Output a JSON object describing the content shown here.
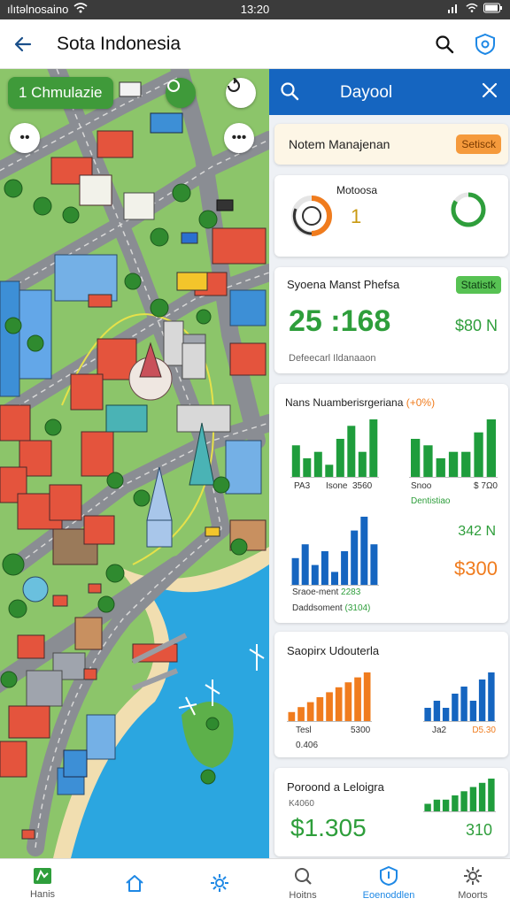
{
  "status_bar": {
    "carrier": "ılıtəlnosaino",
    "time": "13:20"
  },
  "header": {
    "title": "Sota Indonesia"
  },
  "map": {
    "chip_label": "1 Chmulazie",
    "dots_label": "••",
    "more_label": "•••"
  },
  "panel": {
    "title": "Dayool",
    "card1": {
      "label": "Notem Manajenan",
      "badge": "Setisck"
    },
    "card2": {
      "label": "Motoosa",
      "value": "1"
    },
    "card3": {
      "title": "Syoena Manst Phefsa",
      "badge": "Statistk",
      "big_value": "25 :168",
      "side_value": "$80 N",
      "footer": "Defeecarl Ildanaaon"
    },
    "card4": {
      "title": "Nans Nuamberisrgeriana",
      "title_accent": "(+0%)",
      "chart_a_labels": [
        "PA3",
        "Isone",
        "3560"
      ],
      "chart_b_labels": [
        "Snoo",
        "$ 7Ω0"
      ],
      "chart_b_caption": "Dentistiao",
      "value_a": "342 N",
      "chart_c_label": "Sraoe-ment",
      "chart_c_value": "2283",
      "chart_c_caption": "Daddsoment",
      "chart_c_caption_accent": "(3104)",
      "value_b": "$300"
    },
    "card5": {
      "title": "Saopirx Udouterla",
      "labels_left": [
        "Tesl",
        "5300"
      ],
      "sub_left": "0.406",
      "labels_right": [
        "Ja2",
        "D5.30"
      ]
    },
    "card6": {
      "title": "Poroond a Leloigra",
      "sub": "K4060",
      "big_value": "$1.305",
      "side_value": "310"
    }
  },
  "bottom_nav": {
    "items": [
      {
        "label": "Hanis"
      },
      {
        "label": "Hoitns"
      },
      {
        "label": "Eoenoddlen"
      },
      {
        "label": "Moorts"
      }
    ]
  },
  "colors": {
    "blue": "#1565c0",
    "green": "#2e9e3b",
    "orange": "#f07c1e",
    "bar_green": "#1f9d3c",
    "bar_blue": "#1565c0",
    "bar_orange": "#f07c1e"
  },
  "chart_data": [
    {
      "type": "bar",
      "series": [
        {
          "values": [
            5,
            3,
            4,
            2,
            6,
            8,
            4,
            9
          ]
        }
      ]
    },
    {
      "type": "bar",
      "series": [
        {
          "values": [
            6,
            5,
            3,
            4,
            4,
            7,
            9
          ]
        }
      ]
    },
    {
      "type": "bar",
      "series": [
        {
          "values": [
            4,
            6,
            3,
            5,
            2,
            5,
            8,
            10,
            6
          ]
        }
      ]
    },
    {
      "type": "bar",
      "series": [
        {
          "values": [
            2,
            3,
            4,
            5,
            6,
            7,
            8,
            9,
            10
          ]
        }
      ]
    },
    {
      "type": "bar",
      "series": [
        {
          "values": [
            2,
            3,
            2,
            4,
            5,
            3,
            6,
            7
          ]
        }
      ]
    },
    {
      "type": "bar",
      "series": [
        {
          "values": [
            2,
            3,
            3,
            4,
            5,
            6,
            7,
            8
          ]
        }
      ]
    }
  ]
}
